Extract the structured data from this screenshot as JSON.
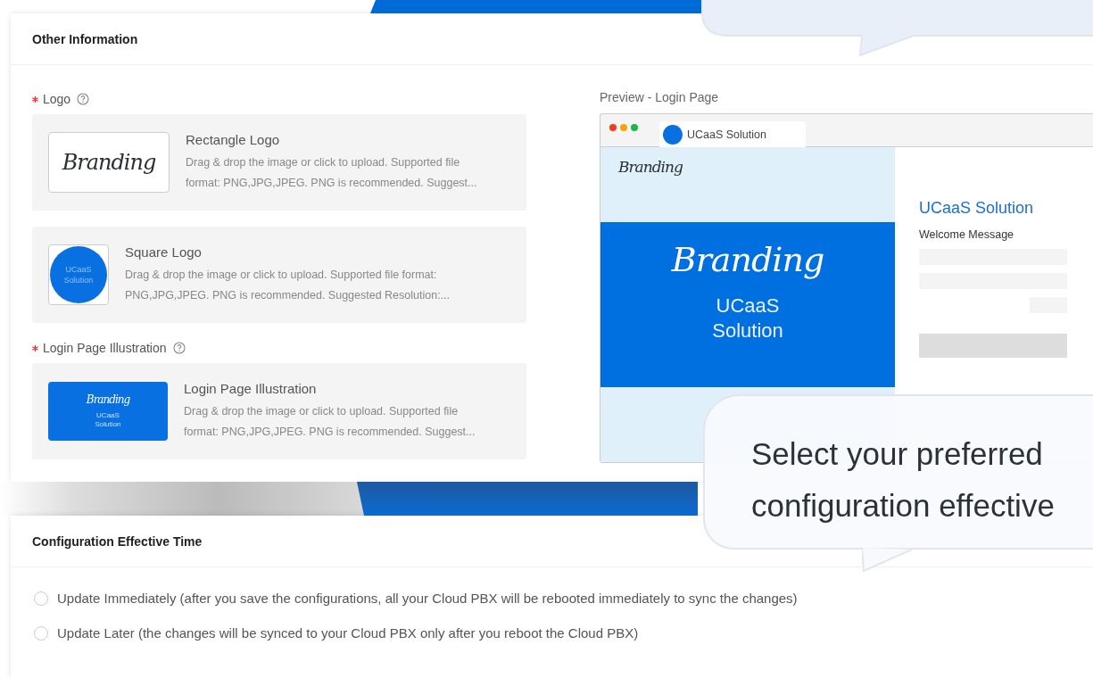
{
  "other_information": {
    "title": "Other Information",
    "fields": [
      {
        "label": "Logo",
        "required": true,
        "help": true,
        "uploads": [
          {
            "kind": "rectangle",
            "title": "Rectangle Logo",
            "description": "Drag & drop the image or click to upload. Supported file format: PNG,JPG,JPEG. PNG is recommended. Suggest...",
            "image_text": [
              "Branding"
            ]
          },
          {
            "kind": "square",
            "title": "Square Logo",
            "description": "Drag & drop the image or click to upload. Supported file format: PNG,JPG,JPEG. PNG is recommended. Suggested Resolution:...",
            "image_text": [
              "UCaaS Solution"
            ]
          }
        ]
      },
      {
        "label": "Login Page Illustration",
        "required": true,
        "help": true,
        "uploads": [
          {
            "kind": "illustration",
            "title": "Login Page Illustration",
            "description": "Drag & drop the image or click to upload. Supported file format: PNG,JPG,JPEG. PNG is recommended. Suggest...",
            "image_text": [
              "Branding",
              "UCaaS Solution"
            ]
          }
        ]
      }
    ],
    "preview": {
      "label": "Preview - Login Page",
      "tab_title": "UCaaS Solution",
      "top_logo": "Branding",
      "banner_logo": "Branding",
      "banner_title": "UCaaS Solution",
      "login_title": "UCaaS Solution",
      "welcome": "Welcome Message"
    }
  },
  "configuration_effective_time": {
    "title": "Configuration Effective Time",
    "options": [
      {
        "label": "Update Immediately (after you save the configurations, all your Cloud PBX will be rebooted immediately to sync the changes)",
        "selected": false
      },
      {
        "label": "Update Later (the changes will be synced to your Cloud PBX only after you reboot the Cloud PBX)",
        "selected": false
      }
    ]
  },
  "callout": {
    "lines": [
      "Select your preferred",
      "configuration effective"
    ]
  }
}
